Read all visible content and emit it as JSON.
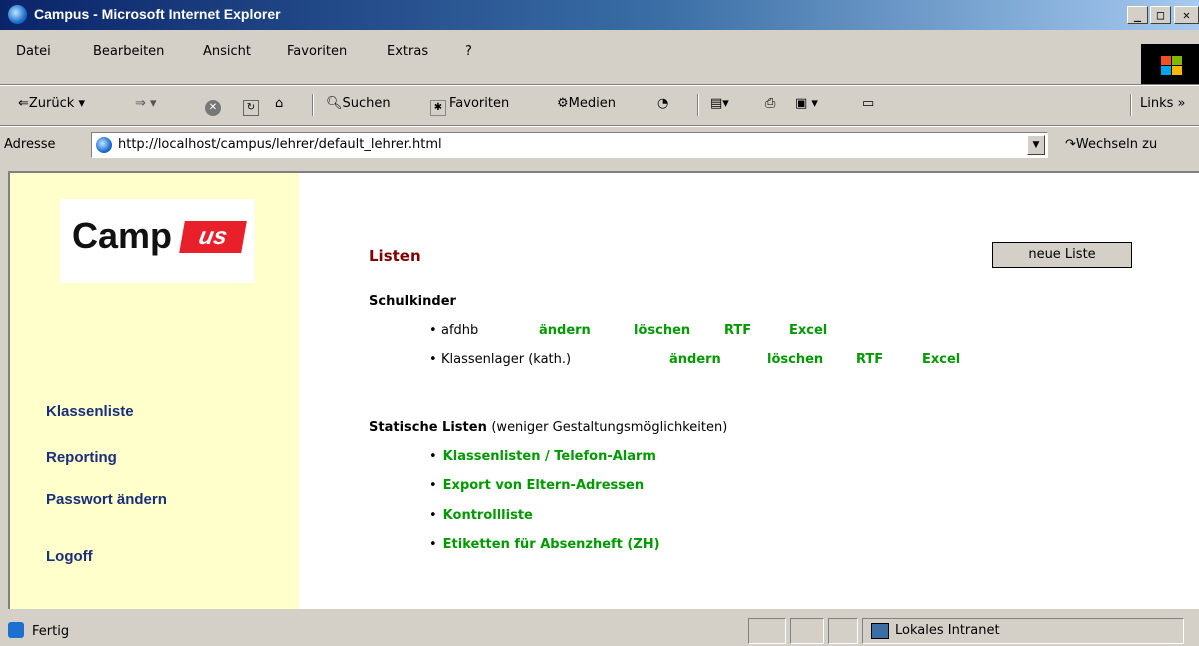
{
  "window": {
    "title": "Campus - Microsoft Internet Explorer"
  },
  "menu": [
    "Datei",
    "Bearbeiten",
    "Ansicht",
    "Favoriten",
    "Extras",
    "?"
  ],
  "toolbar": {
    "back": "Zurück",
    "search": "Suchen",
    "favorites": "Favoriten",
    "media": "Medien",
    "links": "Links"
  },
  "address": {
    "label": "Adresse",
    "url": "http://localhost/campus/lehrer/default_lehrer.html",
    "go": "Wechseln zu"
  },
  "logo": {
    "text_main": "Camp",
    "text_badge": "us"
  },
  "sidebar": {
    "items": [
      "Klassenliste",
      "Reporting",
      "Passwort ändern",
      "Logoff"
    ]
  },
  "main": {
    "heading": "Listen",
    "new_button": "neue Liste",
    "schulkinder": {
      "title": "Schulkinder",
      "rows": [
        {
          "name": "afdhb",
          "actions": [
            "ändern",
            "löschen",
            "RTF",
            "Excel"
          ]
        },
        {
          "name": "Klassenlager (kath.)",
          "actions": [
            "ändern",
            "löschen",
            "RTF",
            "Excel"
          ]
        }
      ]
    },
    "static": {
      "title": "Statische Listen",
      "subtitle": "(weniger Gestaltungsmöglichkeiten)",
      "items": [
        "Klassenlisten / Telefon-Alarm",
        "Export von Eltern-Adressen",
        "Kontrollliste",
        "Etiketten für Absenzheft (ZH)"
      ]
    }
  },
  "status": {
    "text": "Fertig",
    "zone": "Lokales Intranet"
  }
}
